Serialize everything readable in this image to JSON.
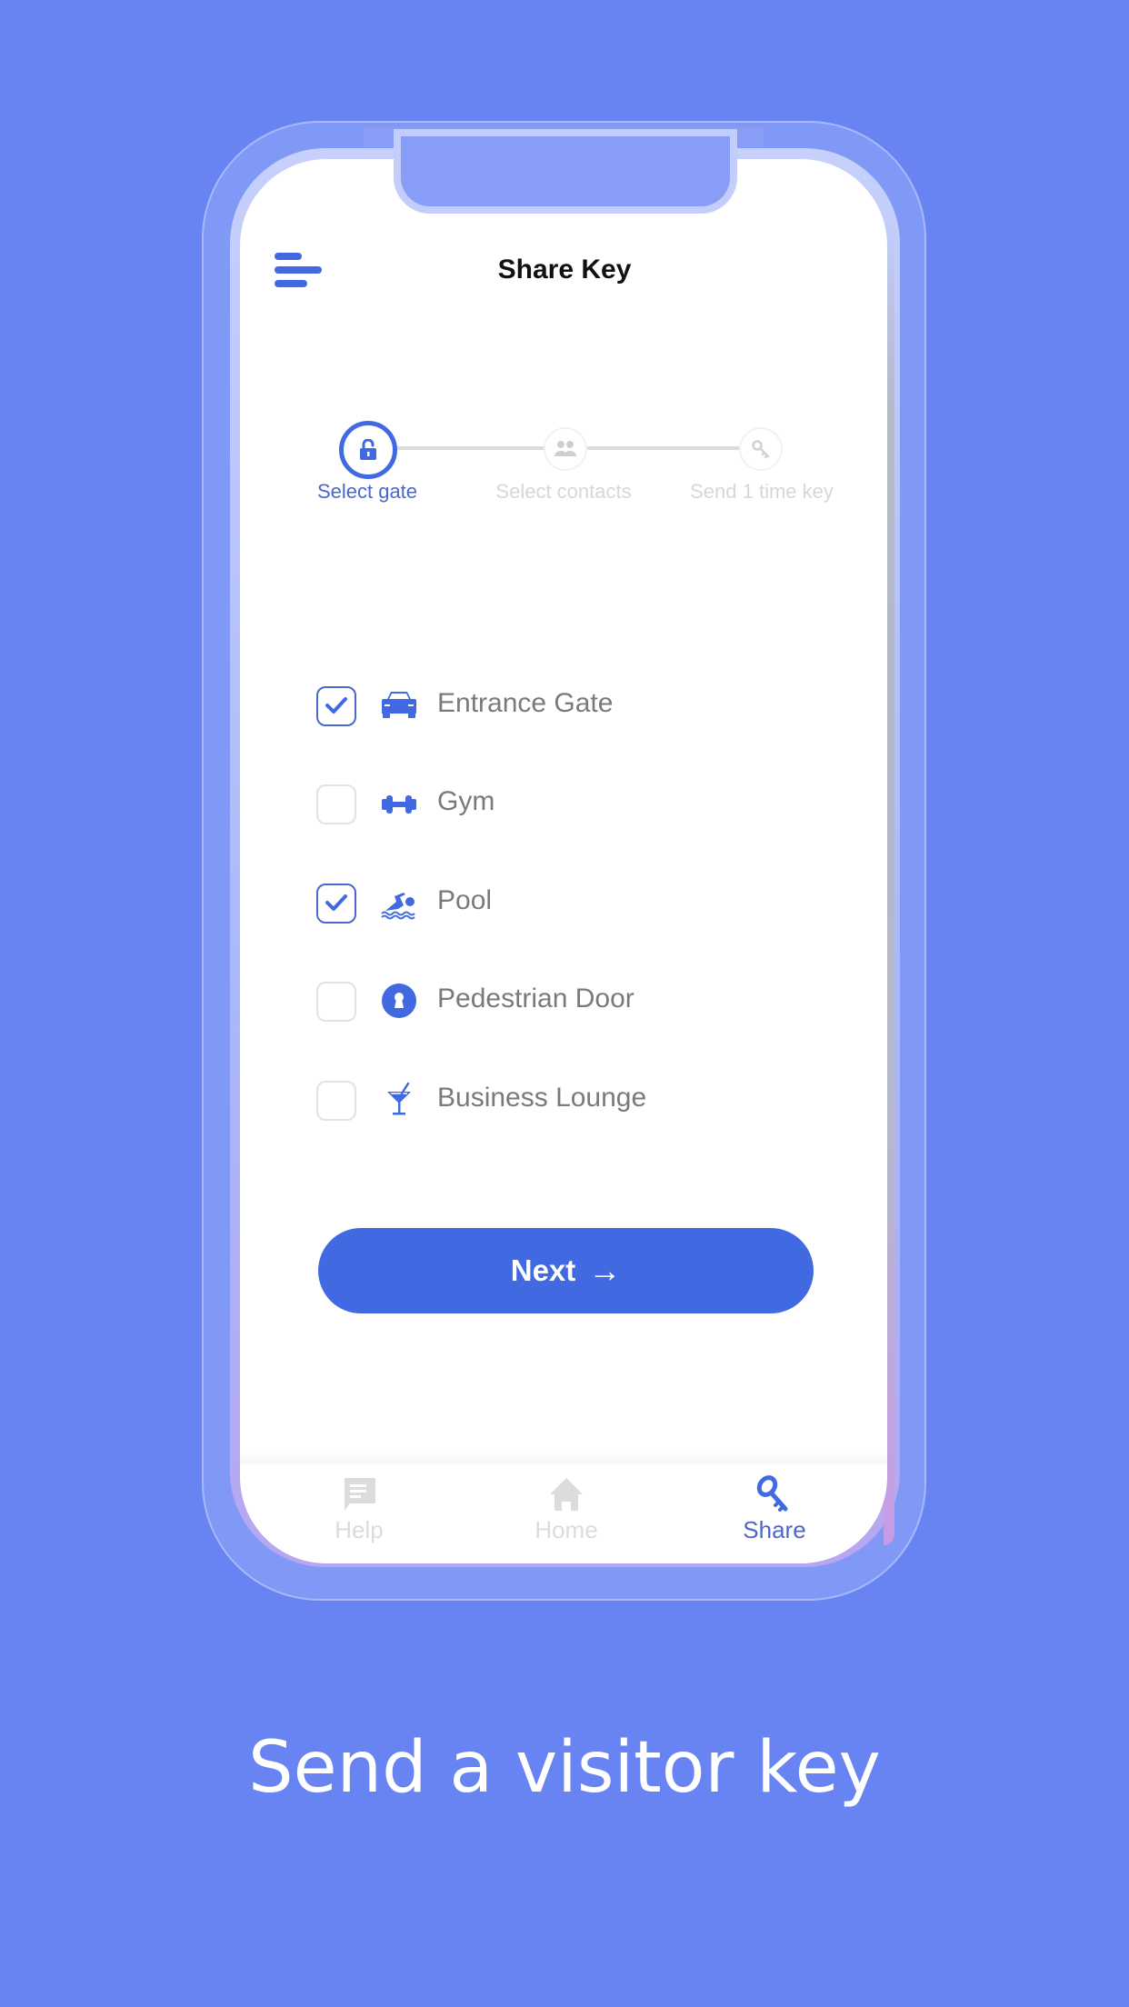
{
  "header": {
    "title": "Share Key",
    "menu_icon": "hamburger-menu-icon"
  },
  "stepper": {
    "steps": [
      {
        "label": "Select gate",
        "icon": "unlock-icon",
        "state": "active"
      },
      {
        "label": "Select contacts",
        "icon": "people-icon",
        "state": "inactive"
      },
      {
        "label": "Send 1 time key",
        "icon": "key-icon",
        "state": "inactive"
      }
    ]
  },
  "gates": [
    {
      "label": "Entrance Gate",
      "icon": "car-icon",
      "checked": true
    },
    {
      "label": "Gym",
      "icon": "dumbbell-icon",
      "checked": false
    },
    {
      "label": "Pool",
      "icon": "swimmer-icon",
      "checked": true
    },
    {
      "label": "Pedestrian Door",
      "icon": "keyhole-icon",
      "checked": false
    },
    {
      "label": "Business Lounge",
      "icon": "cocktail-icon",
      "checked": false
    }
  ],
  "next_button": {
    "label": "Next",
    "icon": "arrow-right-icon",
    "arrow": "→"
  },
  "bottom_nav": {
    "items": [
      {
        "label": "Help",
        "icon": "chat-icon",
        "active": false
      },
      {
        "label": "Home",
        "icon": "home-icon",
        "active": false
      },
      {
        "label": "Share",
        "icon": "key-icon",
        "active": true
      }
    ]
  },
  "caption": "Send a visitor key",
  "colors": {
    "background": "#6784F2",
    "accent": "#4169E1",
    "label_text": "#7A7A7A",
    "inactive": "#DCDCDC"
  }
}
